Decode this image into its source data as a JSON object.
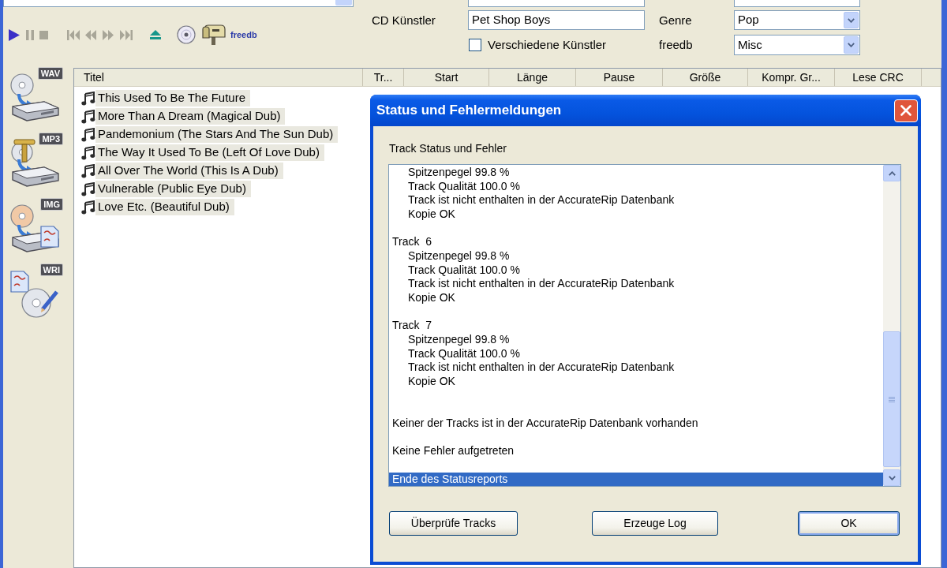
{
  "toolbar": [
    {
      "kind": "play",
      "disabled": false
    },
    {
      "kind": "pause",
      "disabled": true
    },
    {
      "kind": "stop",
      "disabled": true
    },
    {
      "kind": "previous",
      "disabled": true
    },
    {
      "kind": "rewind",
      "disabled": true
    },
    {
      "kind": "forward",
      "disabled": true
    },
    {
      "kind": "next",
      "disabled": true
    },
    {
      "kind": "eject",
      "disabled": false
    },
    {
      "kind": "disc",
      "disabled": false
    },
    {
      "kind": "mailbox",
      "disabled": false
    },
    {
      "kind": "text",
      "label": "freedb",
      "disabled": false
    }
  ],
  "form": {
    "artist": {
      "label": "CD Künstler",
      "value": "Pet Shop Boys"
    },
    "genre": {
      "label": "Genre",
      "value": "Pop"
    },
    "various_artists": {
      "label": "Verschiedene Künstler",
      "checked": false
    },
    "freedb": {
      "label": "freedb",
      "value": "Misc"
    }
  },
  "formats": [
    {
      "kind": "wav",
      "badge": "WAV"
    },
    {
      "kind": "mp3",
      "badge": "MP3"
    },
    {
      "kind": "img",
      "badge": "IMG"
    },
    {
      "kind": "wri",
      "badge": "WRI"
    }
  ],
  "table": {
    "columns": [
      "Titel",
      "Tr...",
      "Start",
      "Länge",
      "Pause",
      "Größe",
      "Kompr. Gr...",
      "Lese CRC"
    ],
    "rows": [
      {
        "title": "This Used To Be The Future",
        "selected": true
      },
      {
        "title": "More Than A Dream (Magical Dub)",
        "selected": true
      },
      {
        "title": "Pandemonium (The Stars And The Sun Dub)",
        "selected": true
      },
      {
        "title": "The Way It Used To Be (Left Of Love Dub)",
        "selected": true
      },
      {
        "title": "All Over The World (This Is A Dub)",
        "selected": true
      },
      {
        "title": "Vulnerable (Public Eye Dub)",
        "selected": true
      },
      {
        "title": "Love Etc. (Beautiful Dub)",
        "selected": true
      }
    ]
  },
  "dialog": {
    "title": "Status und Fehlermeldungen",
    "group_label": "Track Status und Fehler",
    "lines": [
      {
        "kind": "detail",
        "text": "Spitzenpegel 99.8 %",
        "selected": false
      },
      {
        "kind": "detail",
        "text": "Track Qualität 100.0 %",
        "selected": false
      },
      {
        "kind": "detail",
        "text": "Track ist nicht enthalten in der AccurateRip Datenbank",
        "selected": false
      },
      {
        "kind": "detail",
        "text": "Kopie OK",
        "selected": false
      },
      {
        "kind": "gap"
      },
      {
        "kind": "heading",
        "text": "Track  6",
        "selected": false
      },
      {
        "kind": "detail",
        "text": "Spitzenpegel 99.8 %",
        "selected": false
      },
      {
        "kind": "detail",
        "text": "Track Qualität 100.0 %",
        "selected": false
      },
      {
        "kind": "detail",
        "text": "Track ist nicht enthalten in der AccurateRip Datenbank",
        "selected": false
      },
      {
        "kind": "detail",
        "text": "Kopie OK",
        "selected": false
      },
      {
        "kind": "gap"
      },
      {
        "kind": "heading",
        "text": "Track  7",
        "selected": false
      },
      {
        "kind": "detail",
        "text": "Spitzenpegel 99.8 %",
        "selected": false
      },
      {
        "kind": "detail",
        "text": "Track Qualität 100.0 %",
        "selected": false
      },
      {
        "kind": "detail",
        "text": "Track ist nicht enthalten in der AccurateRip Datenbank",
        "selected": false
      },
      {
        "kind": "detail",
        "text": "Kopie OK",
        "selected": false
      },
      {
        "kind": "gap"
      },
      {
        "kind": "gap"
      },
      {
        "kind": "note",
        "text": "Keiner der Tracks ist in der AccurateRip Datenbank vorhanden",
        "selected": false
      },
      {
        "kind": "gap"
      },
      {
        "kind": "note",
        "text": "Keine Fehler aufgetreten",
        "selected": false
      },
      {
        "kind": "gap"
      },
      {
        "kind": "note",
        "text": "Ende des Statusreports",
        "selected": true
      }
    ],
    "buttons": [
      {
        "label": "Überprüfe Tracks",
        "default": false
      },
      {
        "label": "Erzeuge Log",
        "default": false
      },
      {
        "label": "OK",
        "default": true
      }
    ]
  }
}
